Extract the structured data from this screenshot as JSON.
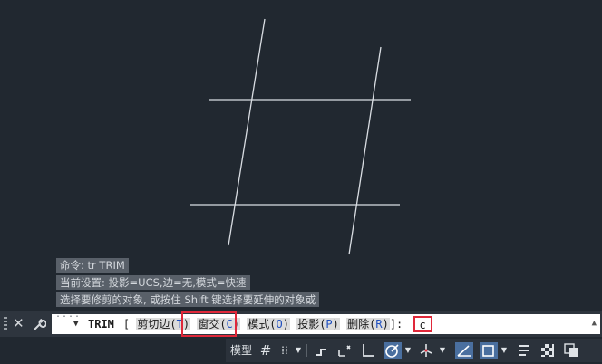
{
  "drawing": {
    "line_color": "#d9dde2",
    "background_color": "#212830"
  },
  "history": {
    "lines": [
      "命令: tr TRIM",
      "当前设置: 投影=UCS,边=无,模式=快速",
      "选择要修剪的对象, 或按住 Shift 键选择要延伸的对象或"
    ]
  },
  "commandbar": {
    "close_icon": "close-icon",
    "customize_icon": "wrench-icon",
    "command_name": "TRIM",
    "open_bracket": "[",
    "options": [
      {
        "label": "剪切边(",
        "hotkey": "T",
        "close": ")"
      },
      {
        "label": "窗交(",
        "hotkey": "C",
        "close": ")"
      },
      {
        "label": "模式(",
        "hotkey": "O",
        "close": ")"
      },
      {
        "label": "投影(",
        "hotkey": "P",
        "close": ")"
      },
      {
        "label": "删除(",
        "hotkey": "R",
        "close": ")"
      }
    ],
    "close_bracket": "]:",
    "input_value": "c",
    "highlight_color": "#e0283a"
  },
  "statusbar": {
    "model_label": "模型",
    "icons": [
      "grid-icon",
      "snap-mode-icon",
      "infer-constraints-icon",
      "dynamic-input-icon",
      "ortho-icon",
      "polar-tracking-icon",
      "isometric-icon",
      "object-snap-tracking-icon",
      "object-snap-icon",
      "lineweight-icon",
      "transparency-icon",
      "selection-cycling-icon"
    ]
  }
}
